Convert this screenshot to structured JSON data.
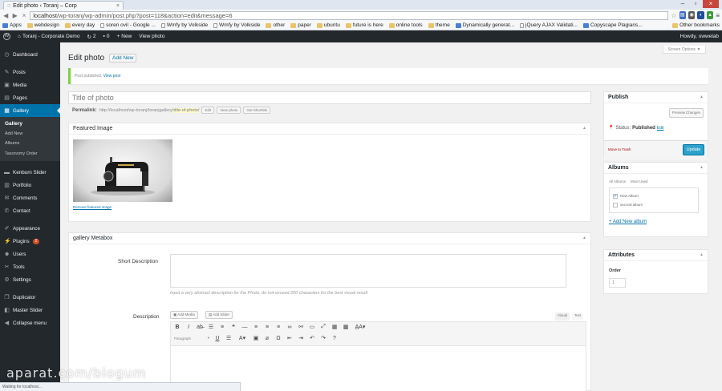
{
  "browser": {
    "tab_title": "Edit photo ‹ Toranj – Corp",
    "url_host": "localhost",
    "url_path": "/wp-toranj/wp-admin/post.php?post=118&action=edit&message=6",
    "bookmarks": [
      "Apps",
      "webdesign",
      "every day",
      "soren ovil - Google ...",
      "Wmfy by Volkside",
      "Wmfy by Volkside",
      "other",
      "paper",
      "ubuntu",
      "future is here",
      "online tools",
      "theme",
      "Dynamically generat...",
      "jQuery AJAX Validati...",
      "Copyscape Plagiaris..."
    ],
    "other_bookmarks": "Other bookmarks",
    "status_text": "Waiting for localhost..."
  },
  "adminbar": {
    "site_name": "Toranj - Corporate Demo",
    "updates_count": "2",
    "comments_count": "0",
    "new_label": "New",
    "view_label": "View photo",
    "howdy": "Howdy, owwelab"
  },
  "sidebar": {
    "items": [
      {
        "label": "Dashboard",
        "icon": "dashboard-icon",
        "glyph": "◷"
      },
      {
        "label": "Posts",
        "icon": "pin-icon",
        "glyph": "✎"
      },
      {
        "label": "Media",
        "icon": "media-icon",
        "glyph": "▣"
      },
      {
        "label": "Pages",
        "icon": "page-icon",
        "glyph": "▤"
      },
      {
        "label": "Gallery",
        "icon": "gallery-icon",
        "glyph": "▦"
      }
    ],
    "submenu": [
      "Gallery",
      "Add New",
      "Albums",
      "Taxonomy Order"
    ],
    "items_after": [
      {
        "label": "Kenburn Slider",
        "icon": "slider-icon",
        "glyph": "▬"
      },
      {
        "label": "Portfolio",
        "icon": "portfolio-icon",
        "glyph": "▥"
      },
      {
        "label": "Comments",
        "icon": "comment-icon",
        "glyph": "✉"
      },
      {
        "label": "Contact",
        "icon": "contact-icon",
        "glyph": "✆"
      }
    ],
    "items_third": [
      {
        "label": "Appearance",
        "icon": "brush-icon",
        "glyph": "✐"
      },
      {
        "label": "Plugins",
        "icon": "plugin-icon",
        "glyph": "⚡",
        "badge": "2"
      },
      {
        "label": "Users",
        "icon": "users-icon",
        "glyph": "☻"
      },
      {
        "label": "Tools",
        "icon": "tools-icon",
        "glyph": "✂"
      },
      {
        "label": "Settings",
        "icon": "settings-icon",
        "glyph": "⚙"
      }
    ],
    "items_fourth": [
      {
        "label": "Duplicator",
        "icon": "duplicator-icon",
        "glyph": "❐"
      },
      {
        "label": "Master Slider",
        "icon": "masterslider-icon",
        "glyph": "◧"
      },
      {
        "label": "Collapse menu",
        "icon": "collapse-icon",
        "glyph": "◀"
      }
    ]
  },
  "main": {
    "title": "Edit photo",
    "add_new": "Add New",
    "screen_options": "Screen Options ▼",
    "notice_text": "Post published.",
    "notice_link": "View post",
    "post_title": "Title of photo",
    "permalink_label": "Permalink:",
    "permalink_url": "http://localhost/wp-toranj/toranjgallery/",
    "permalink_slug": "title-of-photo/",
    "permalink_buttons": [
      "Edit",
      "View photo",
      "Get Shortlink"
    ],
    "featured_title": "Featured Image",
    "remove_featured": "Remove featured image",
    "metabox_title": "gallery Metabox",
    "short_desc_label": "Short Description",
    "short_desc_hint": "Input a very abstract description for the Photo, do not exceed 200 characters for the best visual result",
    "desc_label": "Description",
    "add_media": "Add Media",
    "add_slider": "Add Slider",
    "editor_tabs": [
      "Visual",
      "Text"
    ],
    "paragraph": "Paragraph"
  },
  "publish": {
    "title": "Publish",
    "preview": "Preview Changes",
    "status_label": "Status:",
    "status_value": "Published",
    "status_edit": "Edit",
    "trash": "Move to Trash",
    "update": "Update"
  },
  "albums": {
    "title": "Albums",
    "tabs": [
      "All Albums",
      "Most Used"
    ],
    "items": [
      {
        "label": "New Album",
        "checked": true
      },
      {
        "label": "second album",
        "checked": false
      }
    ],
    "add_new": "+ Add New album"
  },
  "attributes": {
    "title": "Attributes",
    "order_label": "Order",
    "order_value": "1"
  },
  "watermark": "aparat.com/blogum",
  "colors": {
    "accent": "#0073aa",
    "admin_dark": "#23282d",
    "update": "#2ea2cc",
    "notice": "#7ad03a"
  }
}
